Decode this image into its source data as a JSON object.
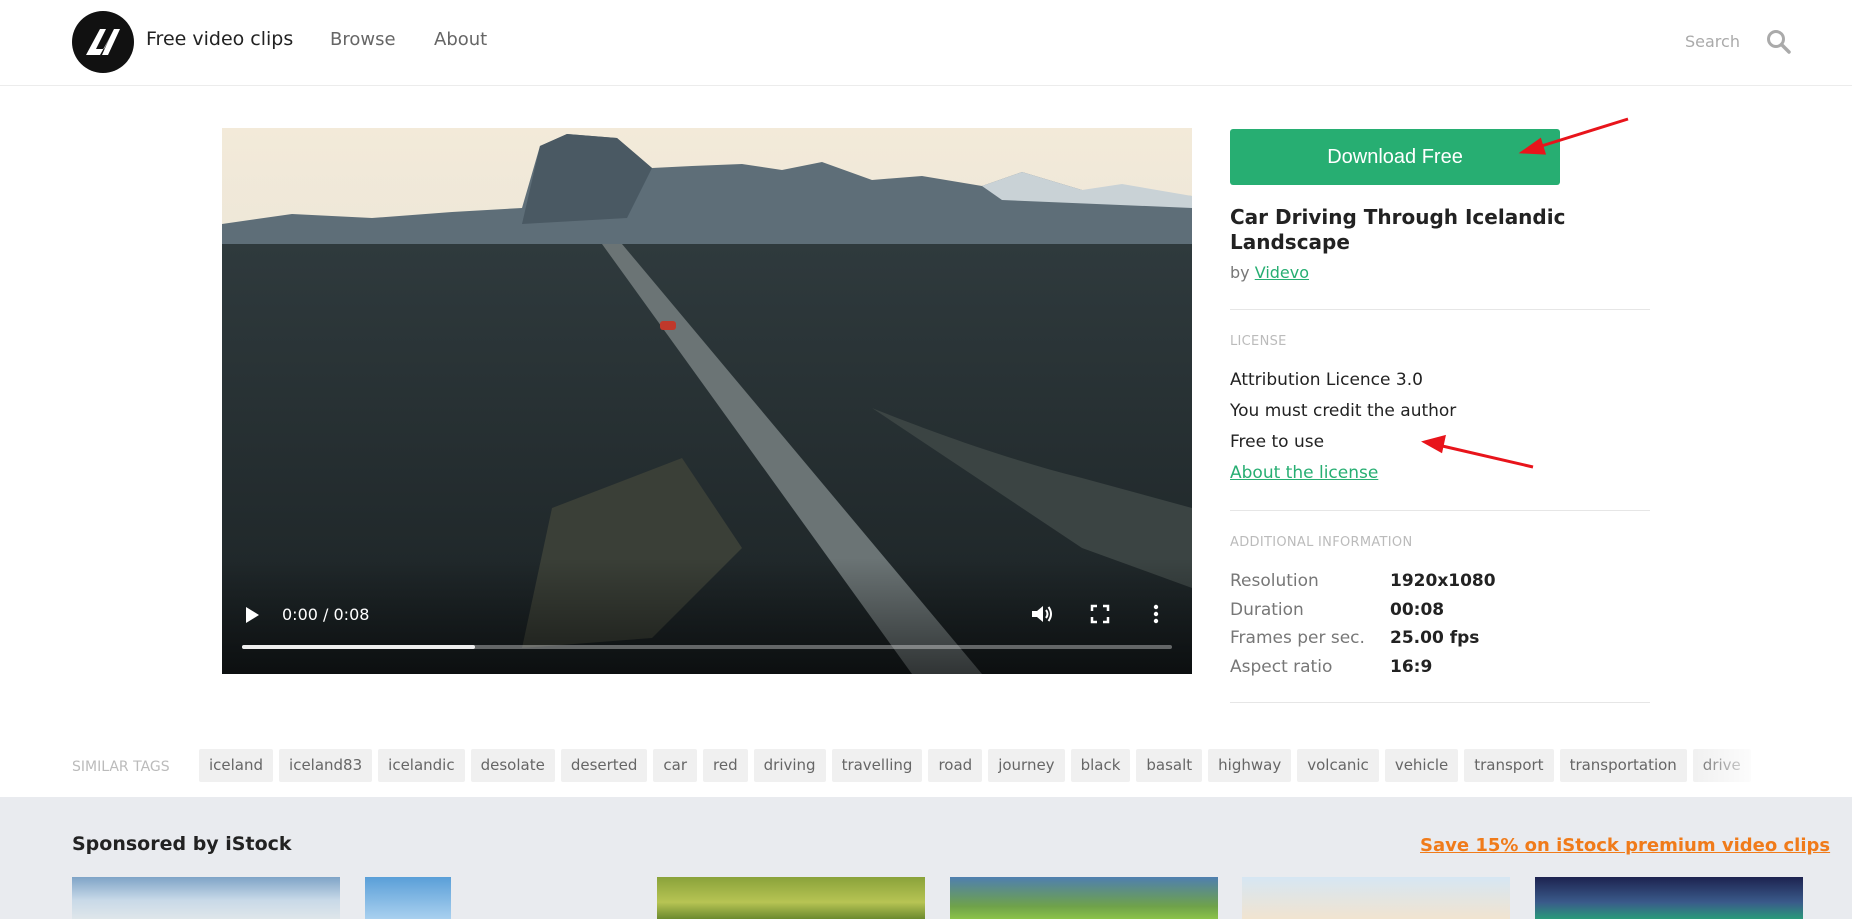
{
  "header": {
    "brand": "Free video clips",
    "nav": {
      "browse": "Browse",
      "about": "About"
    },
    "search_placeholder": "Search"
  },
  "player": {
    "time": "0:00 / 0:08",
    "progress_fraction": 0.25
  },
  "clip": {
    "download_label": "Download Free",
    "title": "Car Driving Through Icelandic Landscape",
    "by_prefix": "by",
    "author": "Videvo"
  },
  "license": {
    "heading": "LICENSE",
    "lines": [
      "Attribution Licence 3.0",
      "You must credit the author",
      "Free to use"
    ],
    "link": "About the license"
  },
  "additional": {
    "heading": "ADDITIONAL INFORMATION",
    "rows": [
      {
        "label": "Resolution",
        "value": "1920x1080"
      },
      {
        "label": "Duration",
        "value": "00:08"
      },
      {
        "label": "Frames per sec.",
        "value": "25.00 fps"
      },
      {
        "label": "Aspect ratio",
        "value": "16:9"
      }
    ]
  },
  "tags": {
    "label": "SIMILAR TAGS",
    "items": [
      "iceland",
      "iceland83",
      "icelandic",
      "desolate",
      "deserted",
      "car",
      "red",
      "driving",
      "travelling",
      "road",
      "journey",
      "black",
      "basalt",
      "highway",
      "volcanic",
      "vehicle",
      "transport",
      "transportation",
      "drive"
    ]
  },
  "sponsored": {
    "title": "Sponsored by iStock",
    "link": "Save 15% on iStock premium video clips"
  },
  "colors": {
    "accent": "#27ae72",
    "sponsor_link": "#f07b1a",
    "annotation": "#e8141b"
  },
  "icons": [
    "logo-mark",
    "search-icon",
    "play-icon",
    "volume-icon",
    "fullscreen-icon",
    "more-options-icon"
  ]
}
